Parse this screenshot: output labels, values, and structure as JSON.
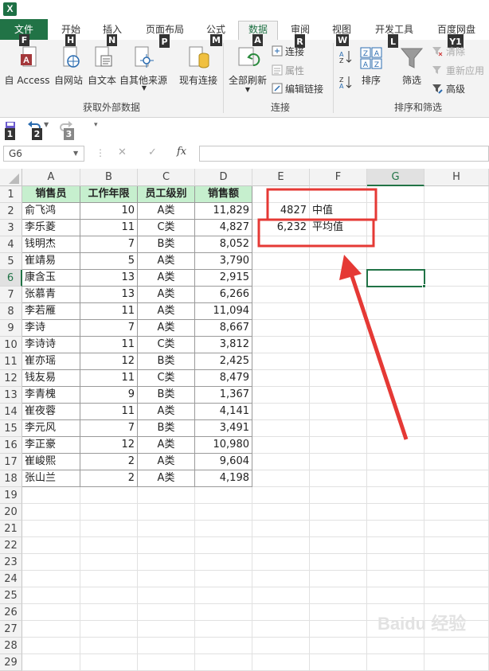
{
  "app": {
    "icon_letter": "X"
  },
  "tabs": [
    {
      "label": "文件",
      "key": "F"
    },
    {
      "label": "开始",
      "key": "H"
    },
    {
      "label": "插入",
      "key": "N"
    },
    {
      "label": "页面布局",
      "key": "P"
    },
    {
      "label": "公式",
      "key": "M"
    },
    {
      "label": "数据",
      "key": "A"
    },
    {
      "label": "审阅",
      "key": "R"
    },
    {
      "label": "视图",
      "key": "W"
    },
    {
      "label": "开发工具",
      "key": "L"
    },
    {
      "label": "百度网盘",
      "key": "Y1"
    }
  ],
  "ribbon": {
    "buttons": {
      "from_access": "自 Access",
      "from_web": "自网站",
      "from_text": "自文本",
      "from_other": "自其他来源",
      "existing_conn": "现有连接",
      "refresh_all": "全部刷新",
      "connections": "连接",
      "properties": "属性",
      "edit_links": "编辑链接",
      "sort": "排序",
      "filter": "筛选",
      "clear": "清除",
      "reapply": "重新应用",
      "advanced": "高级"
    },
    "groups": {
      "external": "获取外部数据",
      "connections": "连接",
      "sortfilter": "排序和筛选"
    }
  },
  "qat": {
    "keys": [
      "1",
      "2",
      "3"
    ]
  },
  "formula_bar": {
    "name_box": "G6",
    "fx": "fx",
    "cancel": "✕",
    "enter": "✓",
    "content": ""
  },
  "columns": [
    "A",
    "B",
    "C",
    "D",
    "E",
    "F",
    "G",
    "H"
  ],
  "rows": [
    "1",
    "2",
    "3",
    "4",
    "5",
    "6",
    "7",
    "8",
    "9",
    "10",
    "11",
    "12",
    "13",
    "14",
    "15",
    "16",
    "17",
    "18",
    "19",
    "20",
    "21",
    "22",
    "23",
    "24",
    "25",
    "26",
    "27",
    "28",
    "29"
  ],
  "table": {
    "headers": [
      "销售员",
      "工作年限",
      "员工级别",
      "销售额"
    ],
    "data": [
      [
        "俞飞鸿",
        "10",
        "A类",
        "11,829"
      ],
      [
        "李乐菱",
        "11",
        "C类",
        "4,827"
      ],
      [
        "钱明杰",
        "7",
        "B类",
        "8,052"
      ],
      [
        "崔靖易",
        "5",
        "A类",
        "3,790"
      ],
      [
        "康含玉",
        "13",
        "A类",
        "2,915"
      ],
      [
        "张慕青",
        "13",
        "A类",
        "6,266"
      ],
      [
        "李若雁",
        "11",
        "A类",
        "11,094"
      ],
      [
        "李诗",
        "7",
        "A类",
        "8,667"
      ],
      [
        "李诗诗",
        "11",
        "C类",
        "3,812"
      ],
      [
        "崔亦瑶",
        "12",
        "B类",
        "2,425"
      ],
      [
        "钱友易",
        "11",
        "C类",
        "8,479"
      ],
      [
        "李青槐",
        "9",
        "B类",
        "1,367"
      ],
      [
        "崔夜蓉",
        "11",
        "A类",
        "4,141"
      ],
      [
        "李元风",
        "7",
        "B类",
        "3,491"
      ],
      [
        "李正豪",
        "12",
        "A类",
        "10,980"
      ],
      [
        "崔峻熙",
        "2",
        "A类",
        "9,604"
      ],
      [
        "张山兰",
        "2",
        "A类",
        "4,198"
      ]
    ]
  },
  "stats": {
    "median_value": "4827",
    "median_label": "中值",
    "mean_value": "6,232",
    "mean_label": "平均值"
  },
  "watermark": "Baidu 经验",
  "colors": {
    "accent": "#217346",
    "header_fill": "#c6efce",
    "annotation": "#e53935"
  }
}
